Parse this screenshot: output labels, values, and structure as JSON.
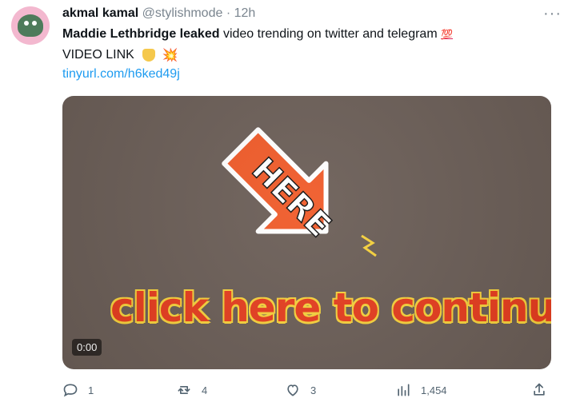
{
  "tweet": {
    "author": {
      "name": "akmal kamal",
      "handle": "@stylishmode",
      "separator": "·",
      "time": "12h"
    },
    "text": {
      "bold_part": "Maddie Lethbridge leaked",
      "rest_part": "video trending on twitter and telegram",
      "line2": "VIDEO LINK",
      "link": "tinyurl.com/h6ked49j"
    },
    "emoji": {
      "hundred": "💯",
      "hand": "👇",
      "burst": "💥"
    },
    "media": {
      "arrow_text": "HERE",
      "cta_text": "click here to continue",
      "duration": "0:00",
      "colors": {
        "background": "#6b5e57",
        "arrow_fill": "#f05a28",
        "arrow_stroke": "#ffffff",
        "cta_text": "#e63d1f",
        "cta_outline": "#f7d23c",
        "accent": "#f7d23c"
      }
    },
    "actions": {
      "reply": "1",
      "retweet": "4",
      "like": "3",
      "views": "1,454"
    },
    "icons": [
      "more-icon",
      "reply-icon",
      "retweet-icon",
      "like-icon",
      "views-icon",
      "share-icon"
    ]
  }
}
